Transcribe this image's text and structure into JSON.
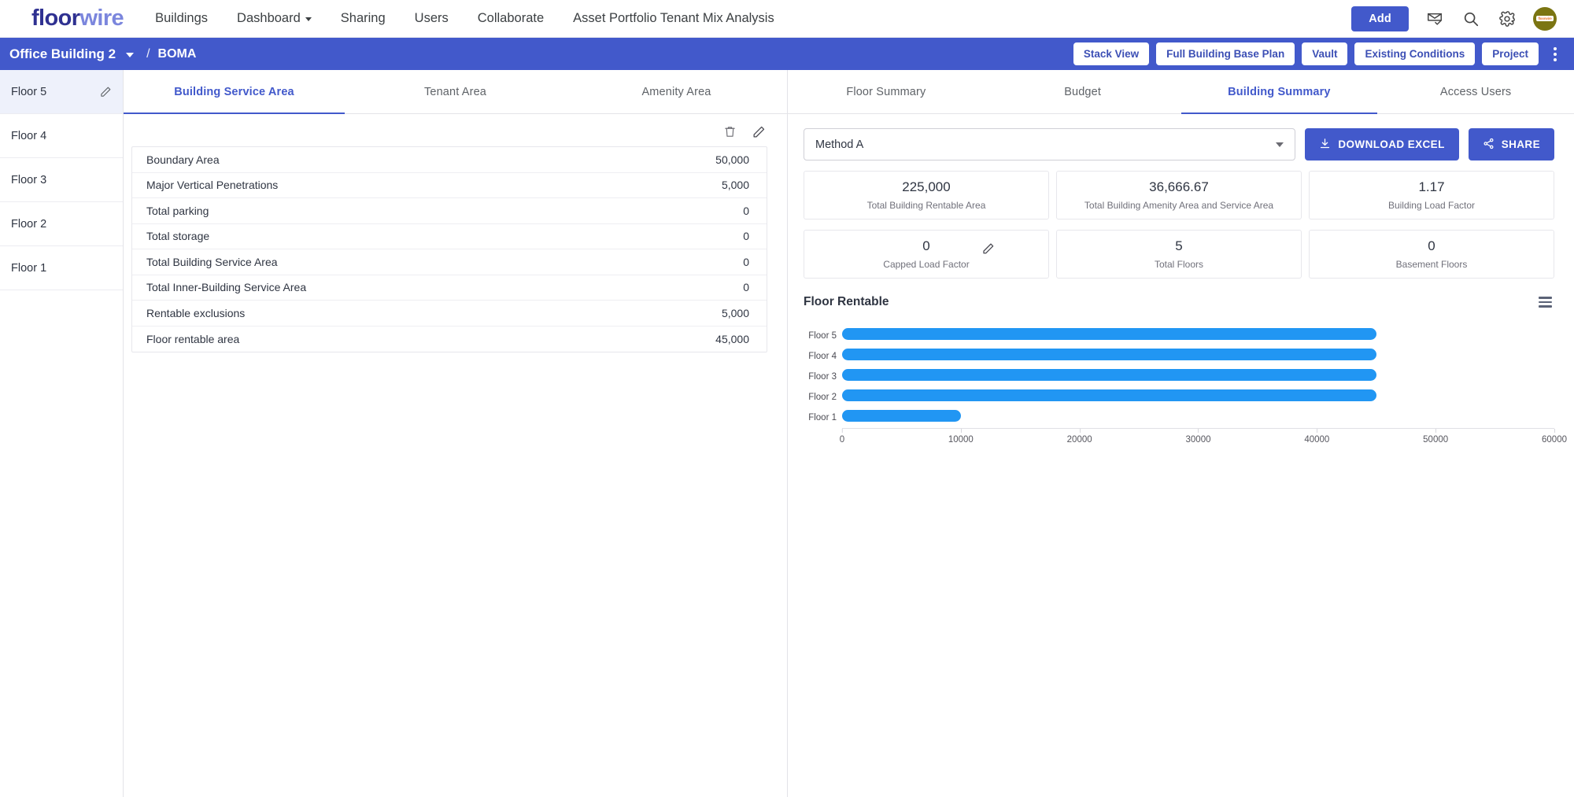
{
  "brand": {
    "part1": "floor",
    "part2": "wire",
    "mark": "bracket-frame-icon"
  },
  "topnav": {
    "links": [
      {
        "label": "Buildings",
        "caret": false
      },
      {
        "label": "Dashboard",
        "caret": true
      },
      {
        "label": "Sharing",
        "caret": false
      },
      {
        "label": "Users",
        "caret": false
      },
      {
        "label": "Collaborate",
        "caret": false
      },
      {
        "label": "Asset Portfolio Tenant Mix Analysis",
        "caret": false
      }
    ],
    "add_label": "Add",
    "avatar_text": "floorwire"
  },
  "breadcrumb": {
    "building": "Office Building 2",
    "separator": "/",
    "section": "BOMA",
    "actions": [
      "Stack View",
      "Full Building Base Plan",
      "Vault",
      "Existing Conditions",
      "Project"
    ]
  },
  "floors": {
    "items": [
      {
        "label": "Floor 5",
        "active": true
      },
      {
        "label": "Floor 4",
        "active": false
      },
      {
        "label": "Floor 3",
        "active": false
      },
      {
        "label": "Floor 2",
        "active": false
      },
      {
        "label": "Floor 1",
        "active": false
      }
    ]
  },
  "left_panel": {
    "tabs": [
      {
        "label": "Building Service Area",
        "active": true
      },
      {
        "label": "Tenant Area",
        "active": false
      },
      {
        "label": "Amenity Area",
        "active": false
      }
    ],
    "rows": [
      {
        "label": "Boundary Area",
        "value": "50,000"
      },
      {
        "label": "Major Vertical Penetrations",
        "value": "5,000"
      },
      {
        "label": "Total parking",
        "value": "0"
      },
      {
        "label": "Total storage",
        "value": "0"
      },
      {
        "label": "Total Building Service Area",
        "value": "0"
      },
      {
        "label": "Total Inner-Building Service Area",
        "value": "0"
      },
      {
        "label": "Rentable exclusions",
        "value": "5,000"
      },
      {
        "label": "Floor rentable area",
        "value": "45,000"
      }
    ]
  },
  "right_panel": {
    "tabs": [
      {
        "label": "Floor Summary",
        "active": false
      },
      {
        "label": "Budget",
        "active": false
      },
      {
        "label": "Building Summary",
        "active": true
      },
      {
        "label": "Access Users",
        "active": false
      }
    ],
    "method_select": {
      "value": "Method A"
    },
    "download_label": "DOWNLOAD EXCEL",
    "share_label": "SHARE",
    "cards": [
      {
        "value": "225,000",
        "label": "Total Building Rentable Area",
        "edit": false
      },
      {
        "value": "36,666.67",
        "label": "Total Building Amenity Area and Service Area",
        "edit": false
      },
      {
        "value": "1.17",
        "label": "Building Load Factor",
        "edit": false
      },
      {
        "value": "0",
        "label": "Capped Load Factor",
        "edit": true
      },
      {
        "value": "5",
        "label": "Total Floors",
        "edit": false
      },
      {
        "value": "0",
        "label": "Basement Floors",
        "edit": false
      }
    ]
  },
  "chart_data": {
    "type": "bar",
    "orientation": "horizontal",
    "title": "Floor Rentable",
    "categories": [
      "Floor 5",
      "Floor 4",
      "Floor 3",
      "Floor 2",
      "Floor 1"
    ],
    "values": [
      45000,
      45000,
      45000,
      45000,
      10000
    ],
    "xlabel": "",
    "ylabel": "",
    "xlim": [
      0,
      60000
    ],
    "xticks": [
      0,
      10000,
      20000,
      30000,
      40000,
      50000,
      60000
    ],
    "xtick_labels": [
      "0",
      "10000",
      "20000",
      "30000",
      "40000",
      "50000",
      "60000"
    ],
    "grid": false,
    "legend": false,
    "bar_color": "#2196f3"
  },
  "colors": {
    "accent": "#4259cb",
    "bar": "#2196f3",
    "brand_dark": "#2f3191",
    "brand_light": "#7b86dd",
    "active_row": "#eef1fb"
  }
}
